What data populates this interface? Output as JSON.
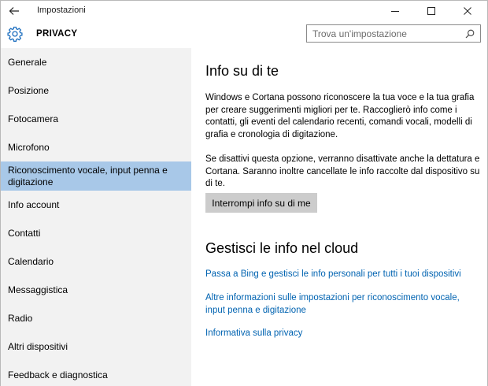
{
  "window": {
    "app_title": "Impostazioni",
    "icons": {
      "back": "back-arrow-icon",
      "minimize": "minimize-icon",
      "maximize": "maximize-icon",
      "close": "close-icon"
    }
  },
  "header": {
    "title": "PRIVACY",
    "icon": "gear-icon",
    "search_placeholder": "Trova un'impostazione"
  },
  "sidebar": {
    "items": [
      {
        "label": "Generale",
        "selected": false
      },
      {
        "label": "Posizione",
        "selected": false
      },
      {
        "label": "Fotocamera",
        "selected": false
      },
      {
        "label": "Microfono",
        "selected": false
      },
      {
        "label": "Riconoscimento vocale, input penna e digitazione",
        "selected": true
      },
      {
        "label": "Info account",
        "selected": false
      },
      {
        "label": "Contatti",
        "selected": false
      },
      {
        "label": "Calendario",
        "selected": false
      },
      {
        "label": "Messaggistica",
        "selected": false
      },
      {
        "label": "Radio",
        "selected": false
      },
      {
        "label": "Altri dispositivi",
        "selected": false
      },
      {
        "label": "Feedback e diagnostica",
        "selected": false
      }
    ]
  },
  "content": {
    "section1_title": "Info su di te",
    "para1": "Windows e Cortana possono riconoscere la tua voce e la tua grafia per creare suggerimenti migliori per te. Raccoglierò info come i contatti, gli eventi del calendario recenti, comandi vocali, modelli di grafia e cronologia di digitazione.",
    "para2": "Se disattivi questa opzione, verranno disattivate anche la dettatura e Cortana. Saranno inoltre cancellate le info raccolte dal dispositivo su di te.",
    "stop_button": "Interrompi info su di me",
    "section2_title": "Gestisci le info nel cloud",
    "link1": "Passa a Bing e gestisci le info personali per tutti i tuoi dispositivi",
    "link2": "Altre informazioni sulle impostazioni per riconoscimento vocale, input penna e digitazione",
    "link3": "Informativa sulla privacy"
  },
  "colors": {
    "accent": "#0063b1",
    "selected": "#a8c8e8",
    "sidebar_bg": "#f2f2f2",
    "button_bg": "#cccccc"
  }
}
